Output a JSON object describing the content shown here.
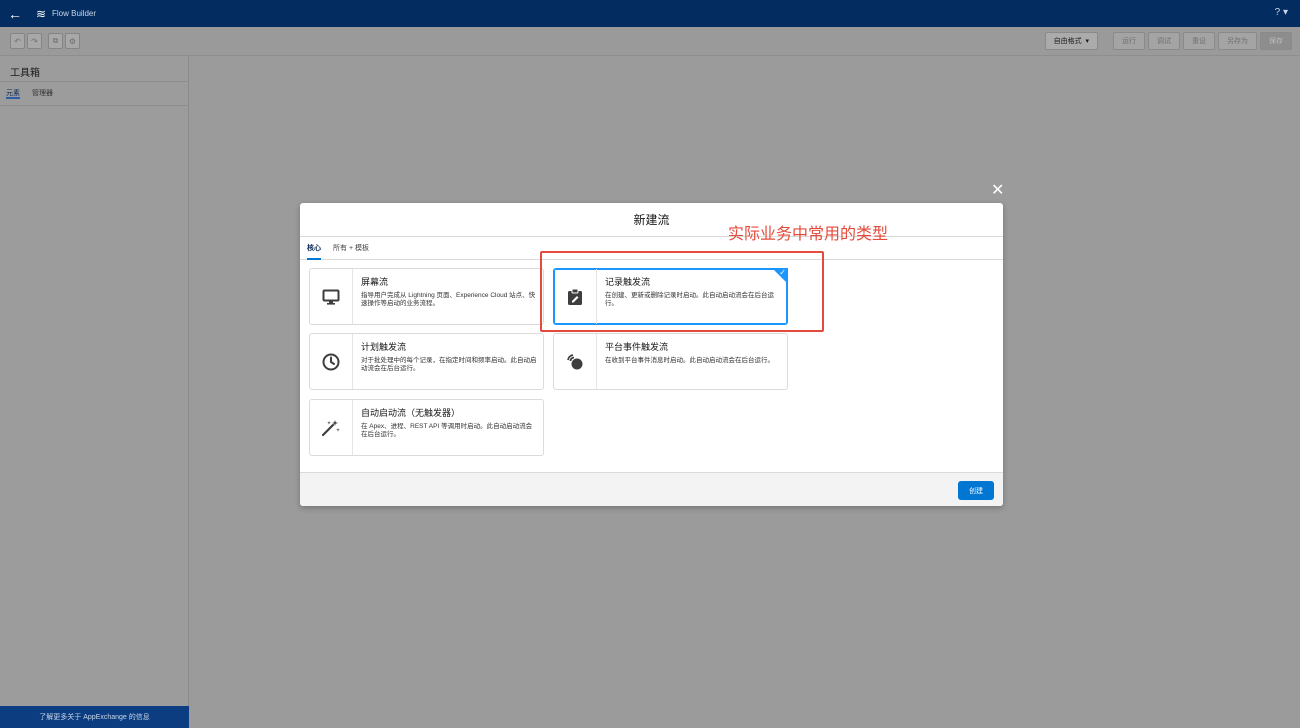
{
  "topbar": {
    "app_title": "Flow Builder",
    "help": "? ▾"
  },
  "toolbar": {
    "mode_label": "自由格式",
    "run": "运行",
    "debug": "调试",
    "reset": "重设",
    "save_as": "另存为",
    "save": "保存"
  },
  "left_panel": {
    "title": "工具箱",
    "tab_elements": "元素",
    "tab_manager": "管理器",
    "footer": "了解更多关于 AppExchange 的信息"
  },
  "modal": {
    "title": "新建流",
    "tab_core": "核心",
    "tab_all": "所有 + 模板",
    "create_button": "创建",
    "cards": [
      {
        "title": "屏幕流",
        "desc": "指导用户完成从 Lightning 页面、Experience Cloud 站点、快速操作等启动的业务流程。",
        "icon": "monitor-icon"
      },
      {
        "title": "记录触发流",
        "desc": "在创建、更新或删除记录时启动。此自动启动流会在后台运行。",
        "icon": "clipboard-edit-icon",
        "selected": true
      },
      {
        "title": "计划触发流",
        "desc": "对于批处理中的每个记录，在指定时间和频率启动。此自动启动流会在后台运行。",
        "icon": "clock-icon"
      },
      {
        "title": "平台事件触发流",
        "desc": "在收到平台事件消息时启动。此自动启动流会在后台运行。",
        "icon": "signal-icon"
      },
      {
        "title": "自动启动流（无触发器）",
        "desc": "在 Apex、进程、REST API 等调用时启动。此自动启动流会在后台运行。",
        "icon": "magic-wand-icon"
      }
    ]
  },
  "annotation": {
    "text": "实际业务中常用的类型",
    "color": "#e54b3c"
  },
  "colors": {
    "brand": "#0176d3",
    "topbar": "#032d60",
    "selected": "#1b96ff"
  }
}
